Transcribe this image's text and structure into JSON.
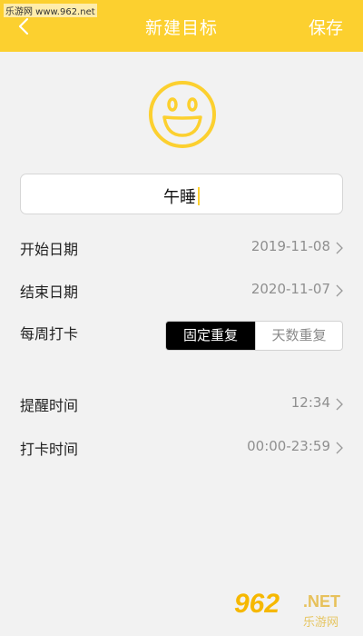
{
  "watermark": "乐游网 www.962.net",
  "header": {
    "title": "新建目标",
    "save_label": "保存",
    "back_icon": "chevron-left-icon",
    "color": "#fcd02f"
  },
  "goal": {
    "icon": "smiley-icon",
    "name_value": "午睡"
  },
  "rows": {
    "start_date": {
      "label": "开始日期",
      "value": "2019-11-08"
    },
    "end_date": {
      "label": "结束日期",
      "value": "2020-11-07"
    },
    "weekly": {
      "label": "每周打卡",
      "options": [
        "固定重复",
        "天数重复"
      ],
      "selected": "固定重复"
    },
    "reminder": {
      "label": "提醒时间",
      "value": "12:34"
    },
    "checkin": {
      "label": "打卡时间",
      "value": "00:00-23:59"
    }
  },
  "logo": {
    "big": "962",
    "net": ".NET",
    "cn": "乐游网"
  }
}
